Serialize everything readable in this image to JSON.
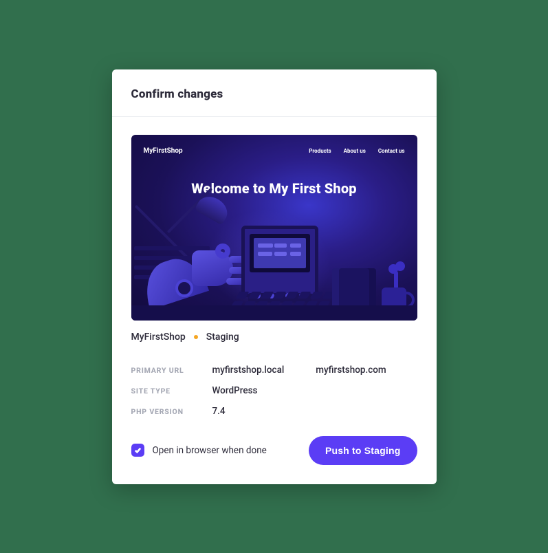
{
  "header": {
    "title": "Confirm changes"
  },
  "preview": {
    "brand": "MyFirstShop",
    "nav": [
      "Products",
      "About us",
      "Contact us"
    ],
    "hero": "Welcome to My First Shop"
  },
  "site": {
    "name": "MyFirstShop",
    "env": "Staging",
    "status_color": "#f5a623"
  },
  "details": {
    "primary_url_label": "PRIMARY URL",
    "primary_url_local": "myfirstshop.local",
    "primary_url_remote": "myfirstshop.com",
    "site_type_label": "SITE TYPE",
    "site_type_value": "WordPress",
    "php_label": "PHP VERSION",
    "php_value": "7.4"
  },
  "footer": {
    "checkbox_label": "Open in browser when done",
    "checkbox_checked": true,
    "button_label": "Push to Staging"
  },
  "colors": {
    "accent": "#5b3df5"
  }
}
